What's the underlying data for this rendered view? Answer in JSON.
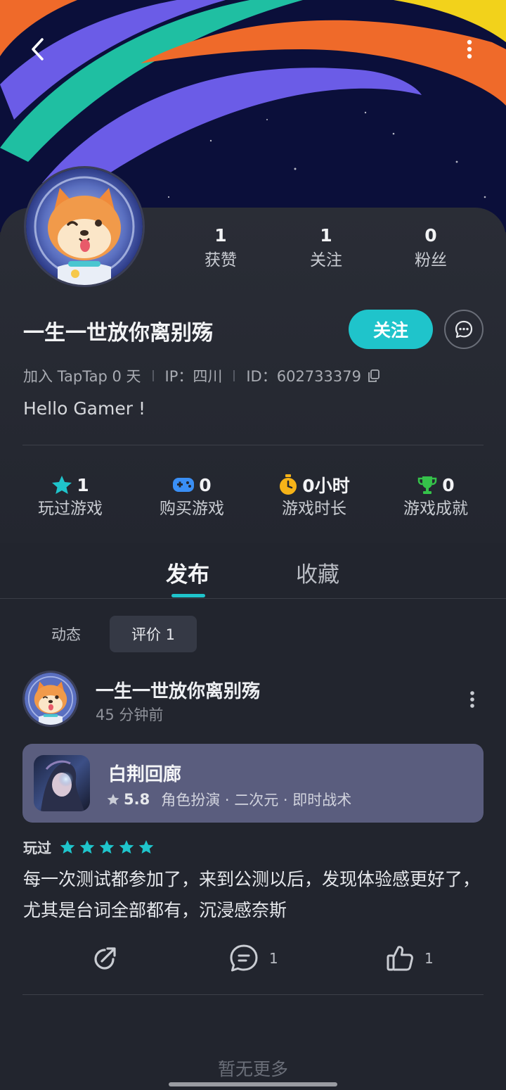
{
  "header": {
    "back_icon": "chevron-left-icon",
    "more_icon": "more-vertical-icon"
  },
  "profile": {
    "username": "一生一世放你离别殇",
    "stats": [
      {
        "value": "1",
        "label": "获赞"
      },
      {
        "value": "1",
        "label": "关注"
      },
      {
        "value": "0",
        "label": "粉丝"
      }
    ],
    "follow_label": "关注",
    "meta": {
      "joined": "加入 TapTap 0 天",
      "ip": "IP：四川",
      "id": "ID：602733379"
    },
    "bio": "Hello Gamer !",
    "game_stats": [
      {
        "icon": "star-icon",
        "value": "1",
        "label": "玩过游戏",
        "color": "#1fc4cb"
      },
      {
        "icon": "gamepad-icon",
        "value": "0",
        "label": "购买游戏",
        "color": "#3a8ff5"
      },
      {
        "icon": "stopwatch-icon",
        "value": "0小时",
        "label": "游戏时长",
        "color": "#f6b318"
      },
      {
        "icon": "trophy-icon",
        "value": "0",
        "label": "游戏成就",
        "color": "#35c24a"
      }
    ]
  },
  "tabs": {
    "publish": "发布",
    "favorites": "收藏"
  },
  "subtabs": {
    "moments": "动态",
    "reviews": "评价 1"
  },
  "post": {
    "username": "一生一世放你离别殇",
    "time": "45 分钟前",
    "game": {
      "title": "白荆回廊",
      "score": "5.8",
      "tags": "角色扮演 · 二次元 · 即时战术"
    },
    "played_label": "玩过",
    "rating": 5,
    "review": "每一次测试都参加了，来到公测以后，发现体验感更好了，尤其是台词全部都有，沉浸感奈斯",
    "comment_count": "1",
    "like_count": "1"
  },
  "footer": {
    "no_more": "暂无更多"
  },
  "colors": {
    "accent": "#1fc4cb",
    "background": "#22252e"
  }
}
